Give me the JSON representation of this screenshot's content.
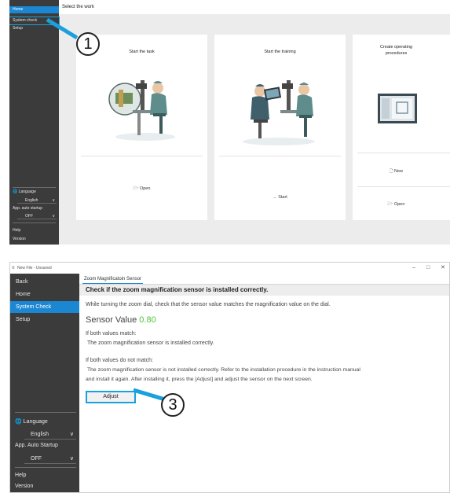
{
  "top": {
    "header": "Select the work",
    "sidebar": {
      "items": [
        "Home",
        "System check",
        "Setup"
      ],
      "language_label": "Language",
      "language_value": "English",
      "auto_startup_label": "App. auto startup",
      "auto_startup_value": "OFF",
      "help": "Help",
      "version": "Version"
    },
    "cards": [
      {
        "title": "Start the task",
        "actions": [
          "Open"
        ]
      },
      {
        "title": "Start the training",
        "actions": [
          "Start"
        ]
      },
      {
        "title": "Create operating\nprocedures",
        "actions": [
          "New",
          "Open"
        ]
      }
    ],
    "callout": "1"
  },
  "bottom": {
    "window_title": "New File - Unsaved",
    "sidebar": {
      "items": [
        "Back",
        "Home",
        "System Check",
        "Setup"
      ],
      "language_label": "Language",
      "language_value": "English",
      "auto_startup_label": "App. Auto Startup",
      "auto_startup_value": "OFF",
      "help": "Help",
      "version": "Version"
    },
    "tab": "Zoom Magnificatoin Sensor",
    "heading": "Check if the zoom magnification sensor is installed correctly.",
    "instruction": "While turning the zoom dial, check that the sensor value matches the magnification value on the dial.",
    "sensor_label": "Sensor Value",
    "sensor_value": "0.80",
    "match_title": "If both values match:",
    "match_body": "The zoom magnification sensor is installed correctly.",
    "nomatch_title": "If both values do not match:",
    "nomatch_line1": "The zoom magnification sensor is not installed correctly. Refer to the installation procedure in the instruction manual",
    "nomatch_line2": "and install it again. After installing it, press the [Adjust] and adjust the sensor on the next screen.",
    "adjust_button": "Adjust",
    "callout": "3"
  },
  "colors": {
    "accent": "#1b87d2",
    "sidebar": "#3b3b3b",
    "callout_line": "#1aa0dc",
    "sensor_value": "#4fc23c"
  }
}
